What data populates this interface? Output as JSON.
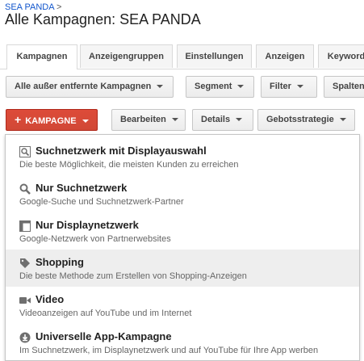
{
  "breadcrumb": {
    "parent": "SEA PANDA",
    "separator": ">"
  },
  "page": {
    "title": "Alle Kampagnen: SEA PANDA"
  },
  "tabs": [
    {
      "label": "Kampagnen",
      "active": true
    },
    {
      "label": "Anzeigengruppen"
    },
    {
      "label": "Einstellungen"
    },
    {
      "label": "Anzeigen"
    },
    {
      "label": "Keyword"
    }
  ],
  "toolbar1": {
    "filter_all": "Alle außer entfernte Kampagnen",
    "segment": "Segment",
    "filter": "Filter",
    "columns": "Spalten"
  },
  "toolbar2": {
    "new_campaign": "KAMPAGNE",
    "edit": "Bearbeiten",
    "details": "Details",
    "bid_strategy": "Gebotsstrategie"
  },
  "menu": {
    "items": [
      {
        "title": "Suchnetzwerk mit Displayauswahl",
        "desc": "Die beste Möglichkeit, die meisten Kunden zu erreichen",
        "icon": "search-display-icon"
      },
      {
        "title": "Nur Suchnetzwerk",
        "desc": "Google-Suche und Suchnetzwerk-Partner",
        "icon": "search-icon"
      },
      {
        "title": "Nur Displaynetzwerk",
        "desc": "Google-Netzwerk von Partnerwebsites",
        "icon": "display-icon"
      },
      {
        "title": "Shopping",
        "desc": "Die beste Methode zum Erstellen von Shopping-Anzeigen",
        "icon": "shopping-tag-icon"
      },
      {
        "title": "Video",
        "desc": "Videoanzeigen auf YouTube und im Internet",
        "icon": "video-icon"
      },
      {
        "title": "Universelle App-Kampagne",
        "desc": "Im Suchnetzwerk, im Displaynetzwerk und auf YouTube für Ihre App werben",
        "icon": "app-download-icon"
      }
    ],
    "highlighted_index": 3
  },
  "colors": {
    "accent_red": "#d14836",
    "link_blue": "#1155cc",
    "icon_gray": "#6f6f6f"
  }
}
